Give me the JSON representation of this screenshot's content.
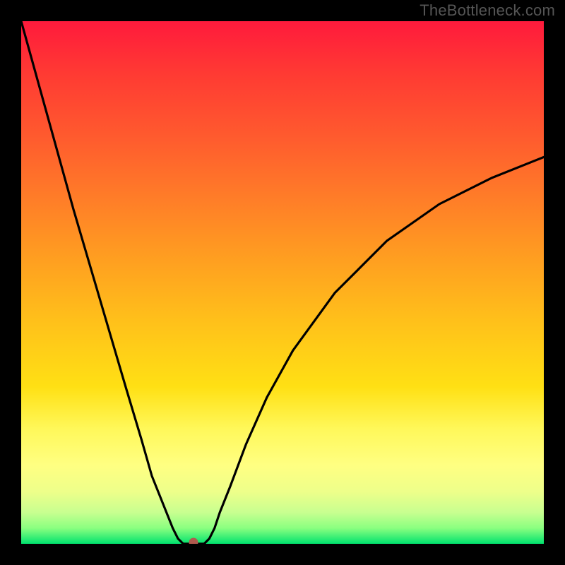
{
  "watermark": "TheBottleneck.com",
  "colors": {
    "frame": "#000000",
    "curve": "#000000",
    "dot": "#b05a4e",
    "gradient_top": "#ff1a3c",
    "gradient_bottom": "#00e26e"
  },
  "chart_data": {
    "type": "line",
    "title": "",
    "xlabel": "",
    "ylabel": "",
    "xlim": [
      0,
      100
    ],
    "ylim": [
      0,
      100
    ],
    "grid": false,
    "legend": false,
    "note": "V-shaped bottleneck curve over heat gradient background; minimum marks the optimal point. No axes or tick labels are shown in the image; numeric values are estimated from pixel geometry.",
    "series": [
      {
        "name": "bottleneck_curve",
        "x": [
          0,
          5,
          10,
          15,
          20,
          23,
          25,
          27,
          29,
          30,
          31,
          32,
          33,
          34,
          35,
          36,
          37,
          38,
          40,
          43,
          47,
          52,
          60,
          70,
          80,
          90,
          100
        ],
        "values": [
          100,
          82,
          64,
          47,
          30,
          20,
          13,
          8,
          3,
          1,
          0,
          0,
          0,
          0,
          0,
          1,
          3,
          6,
          11,
          19,
          28,
          37,
          48,
          58,
          65,
          70,
          74
        ]
      }
    ],
    "optimal_point": {
      "x": 33,
      "y": 0
    },
    "background_gradient_meaning": "top (red) = high bottleneck, bottom (green) = low/zero bottleneck"
  }
}
